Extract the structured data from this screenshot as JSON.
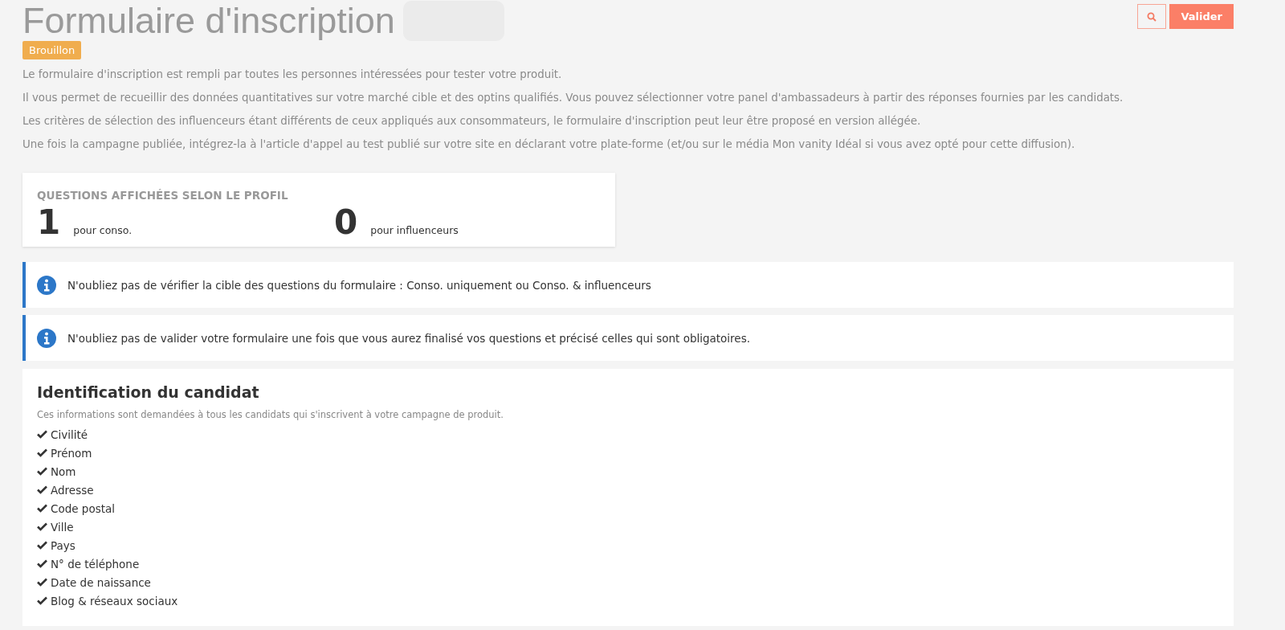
{
  "header": {
    "title": "Formulaire d'inscription",
    "status_badge": "Brouillon",
    "buttons": [
      {
        "kind": "search"
      },
      {
        "kind": "primary",
        "label": "Valider"
      }
    ]
  },
  "intro": [
    "Le formulaire d'inscription est rempli par toutes les personnes intéressées pour tester votre produit.",
    "Il vous permet de recueillir des données quantitatives sur votre marché cible et des optins qualifiés. Vous pouvez sélectionner votre panel d'ambassadeurs à partir des réponses fournies par les candidats.",
    "Les critères de sélection des influenceurs étant différents de ceux appliqués aux consommateurs, le formulaire d'inscription peut leur être proposé en version allégée.",
    "Une fois la campagne publiée, intégrez-la à l'article d'appel au test publié sur votre site en déclarant votre plate-forme (et/ou sur le média Mon vanity Idéal si vous avez opté pour cette diffusion)."
  ],
  "stats": {
    "heading": "QUESTIONS AFFICHÉES SELON LE PROFIL",
    "items": [
      {
        "value": "1",
        "label": "pour conso."
      },
      {
        "value": "0",
        "label": "pour influenceurs"
      }
    ]
  },
  "notices": [
    "N'oubliez pas de vérifier la cible des questions du formulaire : Conso. uniquement ou Conso. & influenceurs",
    "N'oubliez pas de valider votre formulaire une fois que vous aurez finalisé vos questions et précisé celles qui sont obligatoires."
  ],
  "section": {
    "title": "Identification du candidat",
    "subtitle": "Ces informations sont demandées à tous les candidats qui s'inscrivent à votre campagne de produit.",
    "fields": [
      {
        "label": "Civilité",
        "checked": true
      },
      {
        "label": "Prénom",
        "checked": true
      },
      {
        "label": "Nom",
        "checked": true
      },
      {
        "label": "Adresse",
        "checked": true
      },
      {
        "label": "Code postal",
        "checked": true
      },
      {
        "label": "Ville",
        "checked": true
      },
      {
        "label": "Pays",
        "checked": true
      },
      {
        "label": "N° de téléphone",
        "checked": true
      },
      {
        "label": "Date de naissance",
        "checked": true
      },
      {
        "label": "Blog & réseaux sociaux",
        "checked": true
      }
    ]
  }
}
